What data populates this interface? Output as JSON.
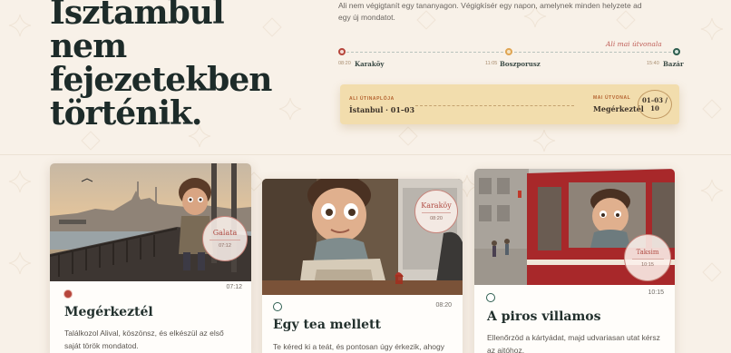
{
  "hero": {
    "lines": [
      "Isztambul",
      "nem",
      "fejezetekben",
      "történik."
    ]
  },
  "intro": {
    "text": "Ali nem végigtanít egy tananyagon. Végigkísér egy napon, amelynek minden helyzete ad egy új mondatot."
  },
  "timeline": {
    "now_label": "Ali mai útvonala",
    "stops": [
      {
        "time": "08:20",
        "name": "Karaköy"
      },
      {
        "time": "11:05",
        "name": "Boszporusz"
      },
      {
        "time": "15:40",
        "name": "Bazár"
      }
    ]
  },
  "ticket": {
    "left_label": "ALI ÚTINAPLÓJA",
    "left_value": "İstanbul · 01–03",
    "right_label": "MAI ÚTVONAL",
    "right_value": "Megérkeztél",
    "stamp": "01–03 / 10"
  },
  "cards": [
    {
      "stamp_place": "Galata",
      "stamp_time": "07:12",
      "time": "07:12",
      "title": "Megérkeztél",
      "desc": "Találkozol Alival, köszönsz, és elkészül az első saját török mondatod."
    },
    {
      "stamp_place": "Karaköy",
      "stamp_time": "08:20",
      "time": "08:20",
      "title": "Egy tea mellett",
      "desc": "Te kéred ki a teát, és pontosan úgy érkezik, ahogy"
    },
    {
      "stamp_place": "Taksim",
      "stamp_time": "10:15",
      "time": "10:15",
      "title": "A piros villamos",
      "desc": "Ellenőrzöd a kártyádat, majd udvariasan utat kérsz az ajtóhoz."
    }
  ],
  "colors": {
    "accent_red": "#b6463c",
    "accent_green": "#2e5e4f",
    "accent_gold": "#e0a553",
    "ticket_bg": "#f2ddad"
  }
}
